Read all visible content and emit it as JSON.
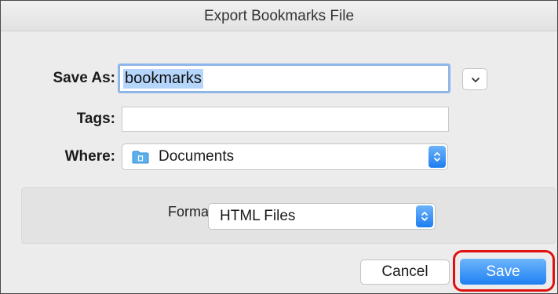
{
  "dialog": {
    "title": "Export Bookmarks File"
  },
  "save_as": {
    "label": "Save As:",
    "value": "bookmarks"
  },
  "tags": {
    "label": "Tags:",
    "value": ""
  },
  "where": {
    "label": "Where:",
    "value": "Documents",
    "icon": "folder-icon"
  },
  "format": {
    "label": "Format:",
    "value": "HTML Files"
  },
  "buttons": {
    "cancel_label": "Cancel",
    "save_label": "Save"
  },
  "colors": {
    "accent_blue": "#1f80f2",
    "selection": "#b5d5fb",
    "focus_ring": "#8fb6e8",
    "highlight_annotation": "#e01010"
  },
  "icons": {
    "expand": "chevron-down-icon",
    "popup_arrows": "up-down-arrows-icon"
  }
}
